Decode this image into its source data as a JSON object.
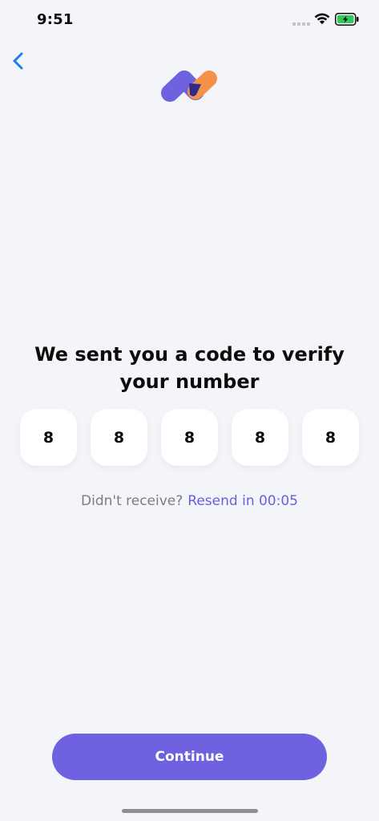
{
  "status_bar": {
    "time": "9:51",
    "signal_icon": "cellular-signal-icon",
    "wifi_icon": "wifi-icon",
    "battery_icon": "battery-charging-icon",
    "battery_color": "#34c759"
  },
  "nav": {
    "back_icon": "chevron-left-icon",
    "accent_color": "#1a7cf5"
  },
  "brand": {
    "logo_icon": "brand-wave-logo",
    "colors": [
      "#6e62e1",
      "#f5924a",
      "#2f2a8c"
    ]
  },
  "verification": {
    "headline": "We sent you a code to verify your number",
    "digits": [
      "8",
      "8",
      "8",
      "8",
      "8"
    ],
    "resend_prompt": "Didn't receive?",
    "resend_link": "Resend in 00:05"
  },
  "footer": {
    "continue_label": "Continue",
    "button_color": "#6e62e1"
  }
}
